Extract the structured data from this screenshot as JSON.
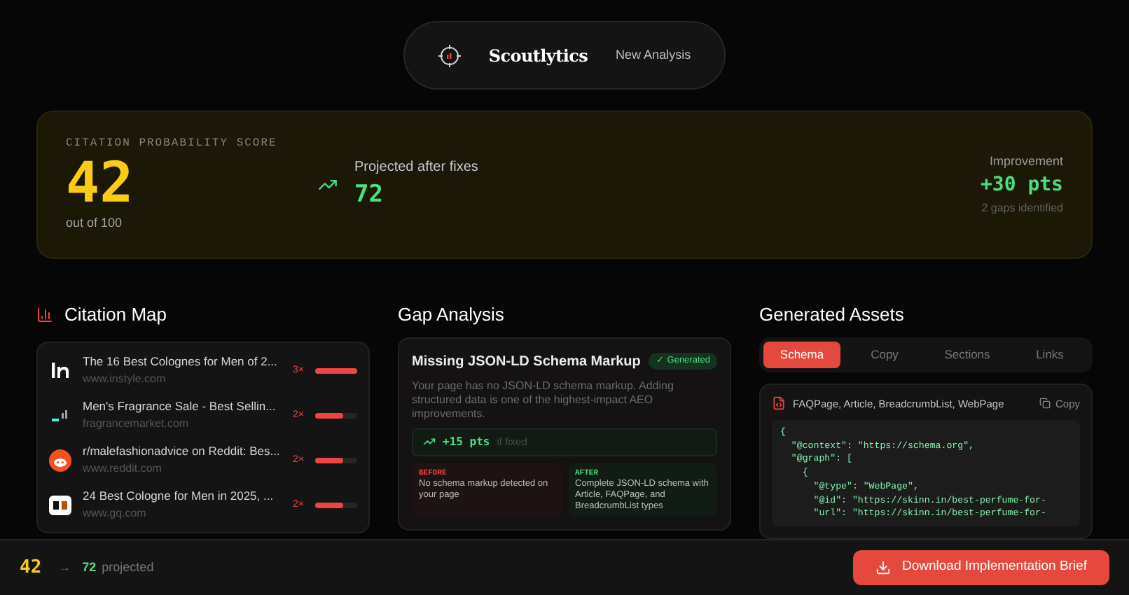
{
  "header": {
    "brand": "Scoutlytics",
    "action": "New Analysis"
  },
  "score": {
    "label": "CITATION PROBABILITY SCORE",
    "value": "42",
    "out_of": "out of 100",
    "projected_label": "Projected after fixes",
    "projected": "72",
    "improvement_label": "Improvement",
    "improvement": "+30 pts",
    "gaps": "2 gaps identified"
  },
  "citation_map": {
    "title": "Citation Map",
    "items": [
      {
        "kind": "instyle",
        "title": "The 16 Best Colognes for Men of 2...",
        "domain": "www.instyle.com",
        "count": "3×",
        "level": 1.0
      },
      {
        "kind": "signal",
        "title": "Men's Fragrance Sale - Best Sellin...",
        "domain": "fragrancemarket.com",
        "count": "2×",
        "level": 0.67
      },
      {
        "kind": "reddit",
        "title": "r/malefashionadvice on Reddit: Bes...",
        "domain": "www.reddit.com",
        "count": "2×",
        "level": 0.67
      },
      {
        "kind": "gq",
        "title": "24 Best Cologne for Men in 2025, ...",
        "domain": "www.gq.com",
        "count": "2×",
        "level": 0.67
      }
    ]
  },
  "gap_analysis": {
    "title": "Gap Analysis",
    "card": {
      "title": "Missing JSON-LD Schema Markup",
      "badge": "✓ Generated",
      "description": "Your page has no JSON-LD schema markup. Adding structured data is one of the highest-impact AEO improvements.",
      "gain": "+15 pts",
      "gain_note": "if fixed",
      "before_label": "BEFORE",
      "before": "No schema markup detected on your page",
      "after_label": "AFTER",
      "after": "Complete JSON-LD schema with Article, FAQPage, and BreadcrumbList types"
    }
  },
  "generated_assets": {
    "title": "Generated Assets",
    "tabs": [
      {
        "label": "Schema",
        "selected": true
      },
      {
        "label": "Copy",
        "selected": false
      },
      {
        "label": "Sections",
        "selected": false
      },
      {
        "label": "Links",
        "selected": false
      }
    ],
    "file_label": "FAQPage, Article, BreadcrumbList, WebPage",
    "copy": "Copy",
    "code": [
      "{",
      "  \"@context\": \"https://schema.org\",",
      "  \"@graph\": [",
      "    {",
      "      \"@type\": \"WebPage\",",
      "      \"@id\": \"https://skinn.in/best-perfume-for-",
      "      \"url\": \"https://skinn.in/best-perfume-for-"
    ]
  },
  "footer": {
    "score": "42",
    "arrow": "→",
    "projected": "72",
    "projected_label": "projected",
    "button": "Download Implementation Brief"
  }
}
